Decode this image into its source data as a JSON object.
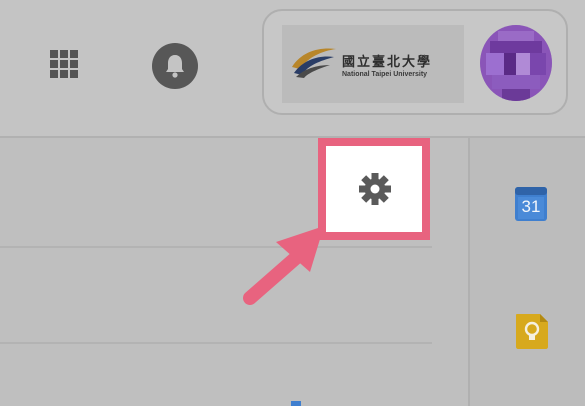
{
  "header": {
    "apps_icon": "apps-grid-icon",
    "notifications_icon": "bell-icon",
    "account": {
      "logo_name_zh": "國立臺北大學",
      "logo_name_en": "National Taipei University",
      "avatar_icon": "pixelated-avatar"
    }
  },
  "main": {
    "settings_icon": "gear-icon",
    "annotation_arrow": "pointer-arrow"
  },
  "side_panel": {
    "calendar_day": "31",
    "calendar_icon": "calendar-icon",
    "keep_icon": "keep-lightbulb-icon"
  },
  "colors": {
    "highlight": "#e8637f",
    "calendar_blue": "#3f7fcf",
    "keep_yellow": "#d7a91d",
    "avatar_purple": "#7f3fb3"
  }
}
